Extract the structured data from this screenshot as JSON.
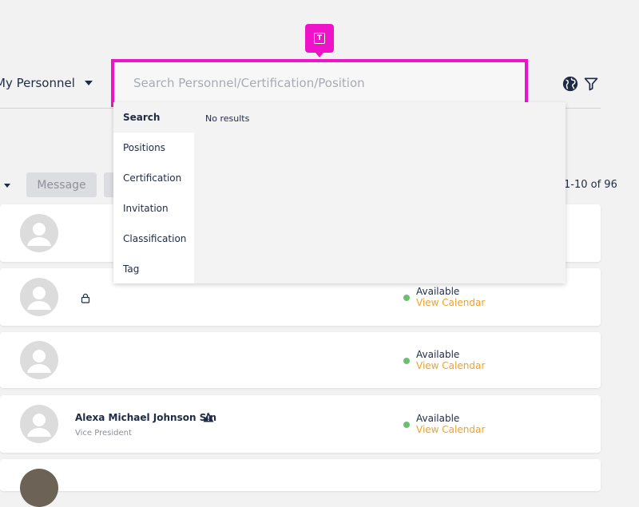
{
  "header": {
    "scope_label": "My Personnel",
    "search": {
      "placeholder": "Search Personnel/Certification/Position",
      "value": ""
    },
    "icons": {
      "globe": "globe-icon",
      "filter": "filter-icon",
      "field_tag": "text-field-icon"
    }
  },
  "toolbar": {
    "message_label": "Message",
    "page_count": "1-10 of 96"
  },
  "dropdown": {
    "categories": [
      "Search",
      "Positions",
      "Certification",
      "Invitation",
      "Classification",
      "Tag"
    ],
    "active_category": "Search",
    "no_results_text": "No results"
  },
  "personnel": [
    {
      "name": "",
      "title": "",
      "status": "",
      "calendar_link": ""
    },
    {
      "name": "",
      "title": "",
      "status": "Available",
      "calendar_link": "View Calendar",
      "locked": true
    },
    {
      "name": "",
      "title": "",
      "status": "Available",
      "calendar_link": "View Calendar"
    },
    {
      "name": "Alexa Michael Johnson Sln",
      "title": "Vice President",
      "status": "Available",
      "calendar_link": "View Calendar",
      "warning": true
    }
  ],
  "colors": {
    "accent_magenta": "#ee12c8",
    "available_green": "#6cbf72",
    "link_orange": "#f0a02a",
    "text_navy": "#1f2a44"
  }
}
